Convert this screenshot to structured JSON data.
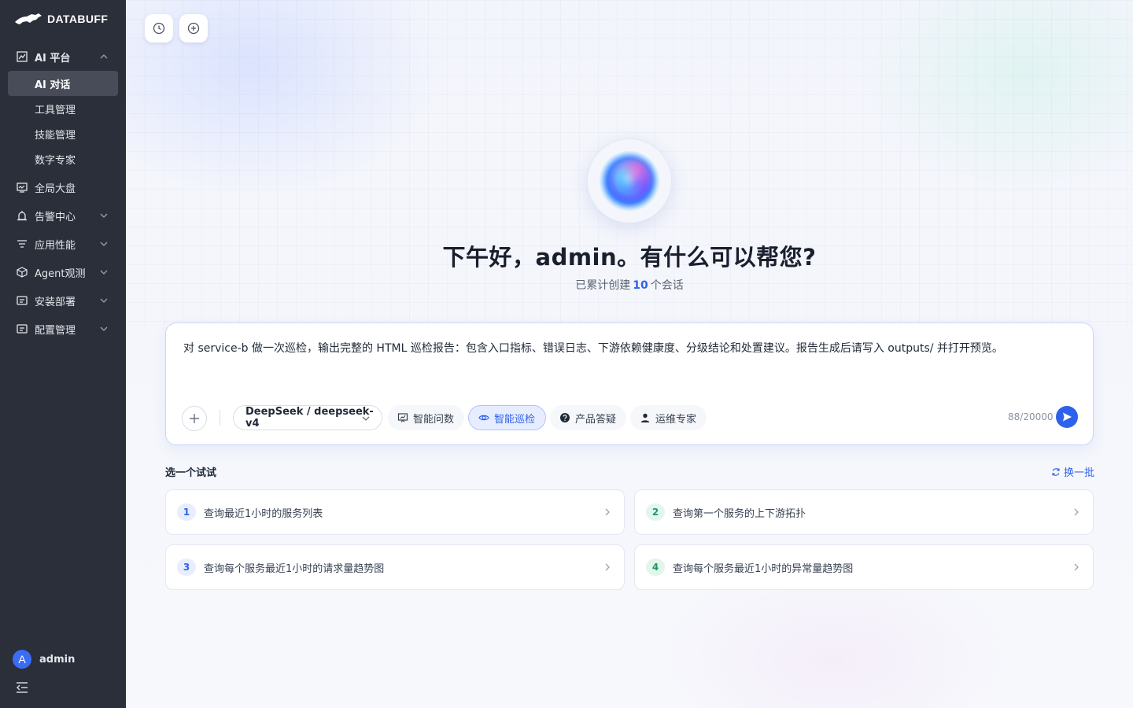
{
  "app": {
    "brand": "DATABUFF"
  },
  "sidebar": {
    "groups": [
      {
        "label": "AI 平台",
        "icon": "ai-chart-icon",
        "expanded": true,
        "items": [
          {
            "label": "AI 对话",
            "active": true
          },
          {
            "label": "工具管理"
          },
          {
            "label": "技能管理"
          },
          {
            "label": "数字专家"
          }
        ]
      },
      {
        "label": "全局大盘",
        "icon": "dashboard-monitor-icon"
      },
      {
        "label": "告警中心",
        "icon": "alarm-icon"
      },
      {
        "label": "应用性能",
        "icon": "filter-lines-icon"
      },
      {
        "label": "Agent观测",
        "icon": "cube-icon"
      },
      {
        "label": "安装部署",
        "icon": "install-doc-icon"
      },
      {
        "label": "配置管理",
        "icon": "config-doc-icon"
      }
    ],
    "user": {
      "initial": "A",
      "name": "admin"
    }
  },
  "main": {
    "greeting": "下午好，admin。有什么可以帮您?",
    "subline": {
      "prefix": "已累计创建",
      "count": "10",
      "suffix": "个会话"
    },
    "input": {
      "text": "对 service-b 做一次巡检，输出完整的 HTML 巡检报告：包含入口指标、错误日志、下游依赖健康度、分级结论和处置建议。报告生成后请写入 outputs/ 并打开预览。",
      "model": "DeepSeek / deepseek-v4",
      "modes": [
        {
          "label": "智能问数",
          "icon": "chart-board-icon",
          "active": false
        },
        {
          "label": "智能巡检",
          "icon": "eye-icon",
          "active": true
        },
        {
          "label": "产品答疑",
          "icon": "question-icon",
          "active": false
        },
        {
          "label": "运维专家",
          "icon": "person-icon",
          "active": false
        }
      ],
      "counter": "88/20000"
    },
    "suggestions": {
      "title": "选一个试试",
      "refresh": "换一批",
      "items": [
        {
          "num": "1",
          "text": "查询最近1小时的服务列表"
        },
        {
          "num": "2",
          "text": "查询第一个服务的上下游拓扑"
        },
        {
          "num": "3",
          "text": "查询每个服务最近1小时的请求量趋势图"
        },
        {
          "num": "4",
          "text": "查询每个服务最近1小时的异常量趋势图"
        }
      ]
    }
  },
  "colors": {
    "accent": "#2f62ea",
    "sidebar_bg": "#2b2f3a",
    "green": "#1c9a64"
  }
}
